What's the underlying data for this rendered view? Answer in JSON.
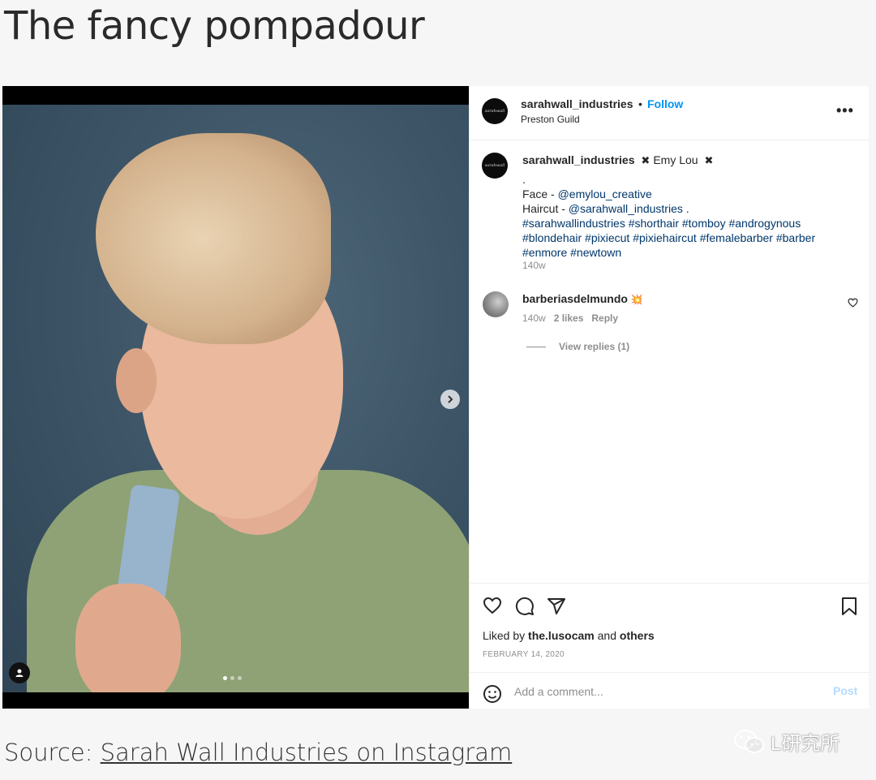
{
  "article": {
    "title": "The fancy pompadour",
    "source_prefix": "Source: ",
    "source_link": "Sarah Wall Industries on Instagram",
    "watermark": "L研究所"
  },
  "post": {
    "header": {
      "username": "sarahwall_industries",
      "separator": "•",
      "follow_label": "Follow",
      "location": "Preston Guild",
      "avatar_text": "sarahwall"
    },
    "caption": {
      "username": "sarahwall_industries",
      "x1": "✖",
      "tag_name": "Emy Lou",
      "x2": "✖",
      "dot_line": ".",
      "face_prefix": "Face - ",
      "face_handle": "@emylou_creative",
      "haircut_prefix": "Haircut - ",
      "haircut_handle": "@sarahwall_industries",
      "haircut_suffix": " .",
      "hashtags_line1": "#sarahwallindustries #shorthair #tomboy #androgynous",
      "hashtags_line2": "#blondehair #pixiecut #pixiehaircut #femalebarber #barber",
      "hashtags_line3": "#enmore #newtown",
      "time": "140w"
    },
    "comment": {
      "username": "barberiasdelmundo",
      "emoji": "💥",
      "time": "140w",
      "likes": "2 likes",
      "reply_label": "Reply",
      "view_replies": "View replies (1)"
    },
    "actions": {
      "icons": [
        "heart-icon",
        "comment-icon",
        "share-icon",
        "bookmark-icon"
      ],
      "liked_prefix": "Liked by ",
      "liked_user": "the.lusocam",
      "liked_and": " and ",
      "liked_others": "others",
      "date": "FEBRUARY 14, 2020"
    },
    "add_comment": {
      "placeholder": "Add a comment...",
      "post_label": "Post"
    },
    "carousel": {
      "slide_count": 3,
      "active_index": 0
    }
  },
  "colors": {
    "follow_blue": "#0095f6",
    "link_blue": "#00376b",
    "muted": "#8e8e8e",
    "post_disabled": "#b3dbff"
  }
}
